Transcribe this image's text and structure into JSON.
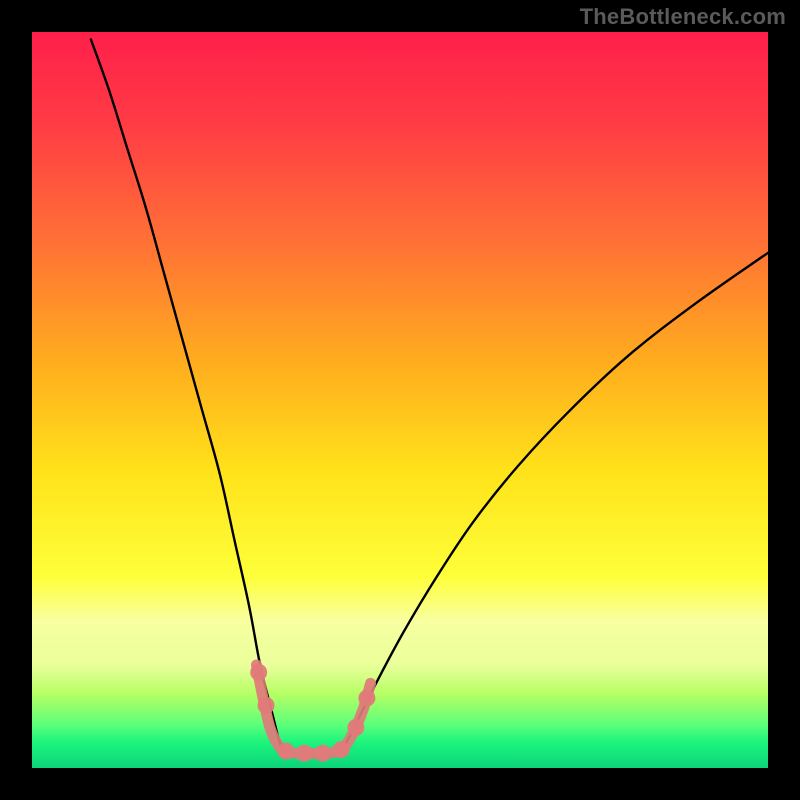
{
  "watermark": "TheBottleneck.com",
  "chart_data": {
    "type": "line",
    "title": "",
    "xlabel": "",
    "ylabel": "",
    "xlim": [
      0,
      100
    ],
    "ylim": [
      0,
      100
    ],
    "legend": false,
    "gradient_stops": [
      {
        "offset": 0.0,
        "color": "#ff1f4a"
      },
      {
        "offset": 0.12,
        "color": "#ff3a45"
      },
      {
        "offset": 0.28,
        "color": "#ff6f36"
      },
      {
        "offset": 0.45,
        "color": "#ffad1e"
      },
      {
        "offset": 0.6,
        "color": "#ffe31a"
      },
      {
        "offset": 0.74,
        "color": "#feff3a"
      },
      {
        "offset": 0.8,
        "color": "#f8ffa0"
      },
      {
        "offset": 0.86,
        "color": "#eaff9a"
      },
      {
        "offset": 0.9,
        "color": "#b4ff64"
      },
      {
        "offset": 0.94,
        "color": "#5fff7a"
      },
      {
        "offset": 0.965,
        "color": "#1cf57c"
      },
      {
        "offset": 1.0,
        "color": "#0cd47a"
      }
    ],
    "series": [
      {
        "name": "left-curve",
        "stroke": "#000000",
        "x": [
          8.0,
          10.5,
          13.0,
          15.5,
          18.0,
          20.5,
          23.0,
          25.5,
          27.5,
          29.5,
          31.0,
          32.5,
          33.5,
          34.0
        ],
        "y": [
          99.0,
          92.0,
          84.0,
          76.0,
          67.0,
          58.0,
          49.0,
          40.0,
          31.0,
          22.0,
          14.0,
          8.0,
          4.0,
          2.5
        ]
      },
      {
        "name": "right-curve",
        "stroke": "#000000",
        "x": [
          42.0,
          43.0,
          44.5,
          47.0,
          50.5,
          55.0,
          60.0,
          66.0,
          73.0,
          81.0,
          90.0,
          100.0
        ],
        "y": [
          2.5,
          4.0,
          7.0,
          12.0,
          18.5,
          26.0,
          33.5,
          41.0,
          48.5,
          56.0,
          63.0,
          70.0
        ]
      },
      {
        "name": "bottom-highlight",
        "stroke": "#e07a7a",
        "x": [
          30.5,
          31.5,
          32.5,
          34.0,
          36.0,
          38.0,
          40.0,
          42.0,
          43.5,
          45.0,
          46.0
        ],
        "y": [
          14.0,
          9.0,
          5.0,
          2.5,
          2.0,
          2.0,
          2.0,
          2.5,
          4.5,
          8.0,
          11.5
        ]
      }
    ],
    "highlight_markers": {
      "color": "#e07a7a",
      "points": [
        {
          "x": 30.8,
          "y": 13.0
        },
        {
          "x": 31.8,
          "y": 8.5
        },
        {
          "x": 34.5,
          "y": 2.3
        },
        {
          "x": 37.0,
          "y": 2.0
        },
        {
          "x": 39.5,
          "y": 2.0
        },
        {
          "x": 42.0,
          "y": 2.5
        },
        {
          "x": 44.0,
          "y": 5.5
        },
        {
          "x": 45.5,
          "y": 9.5
        }
      ]
    }
  }
}
